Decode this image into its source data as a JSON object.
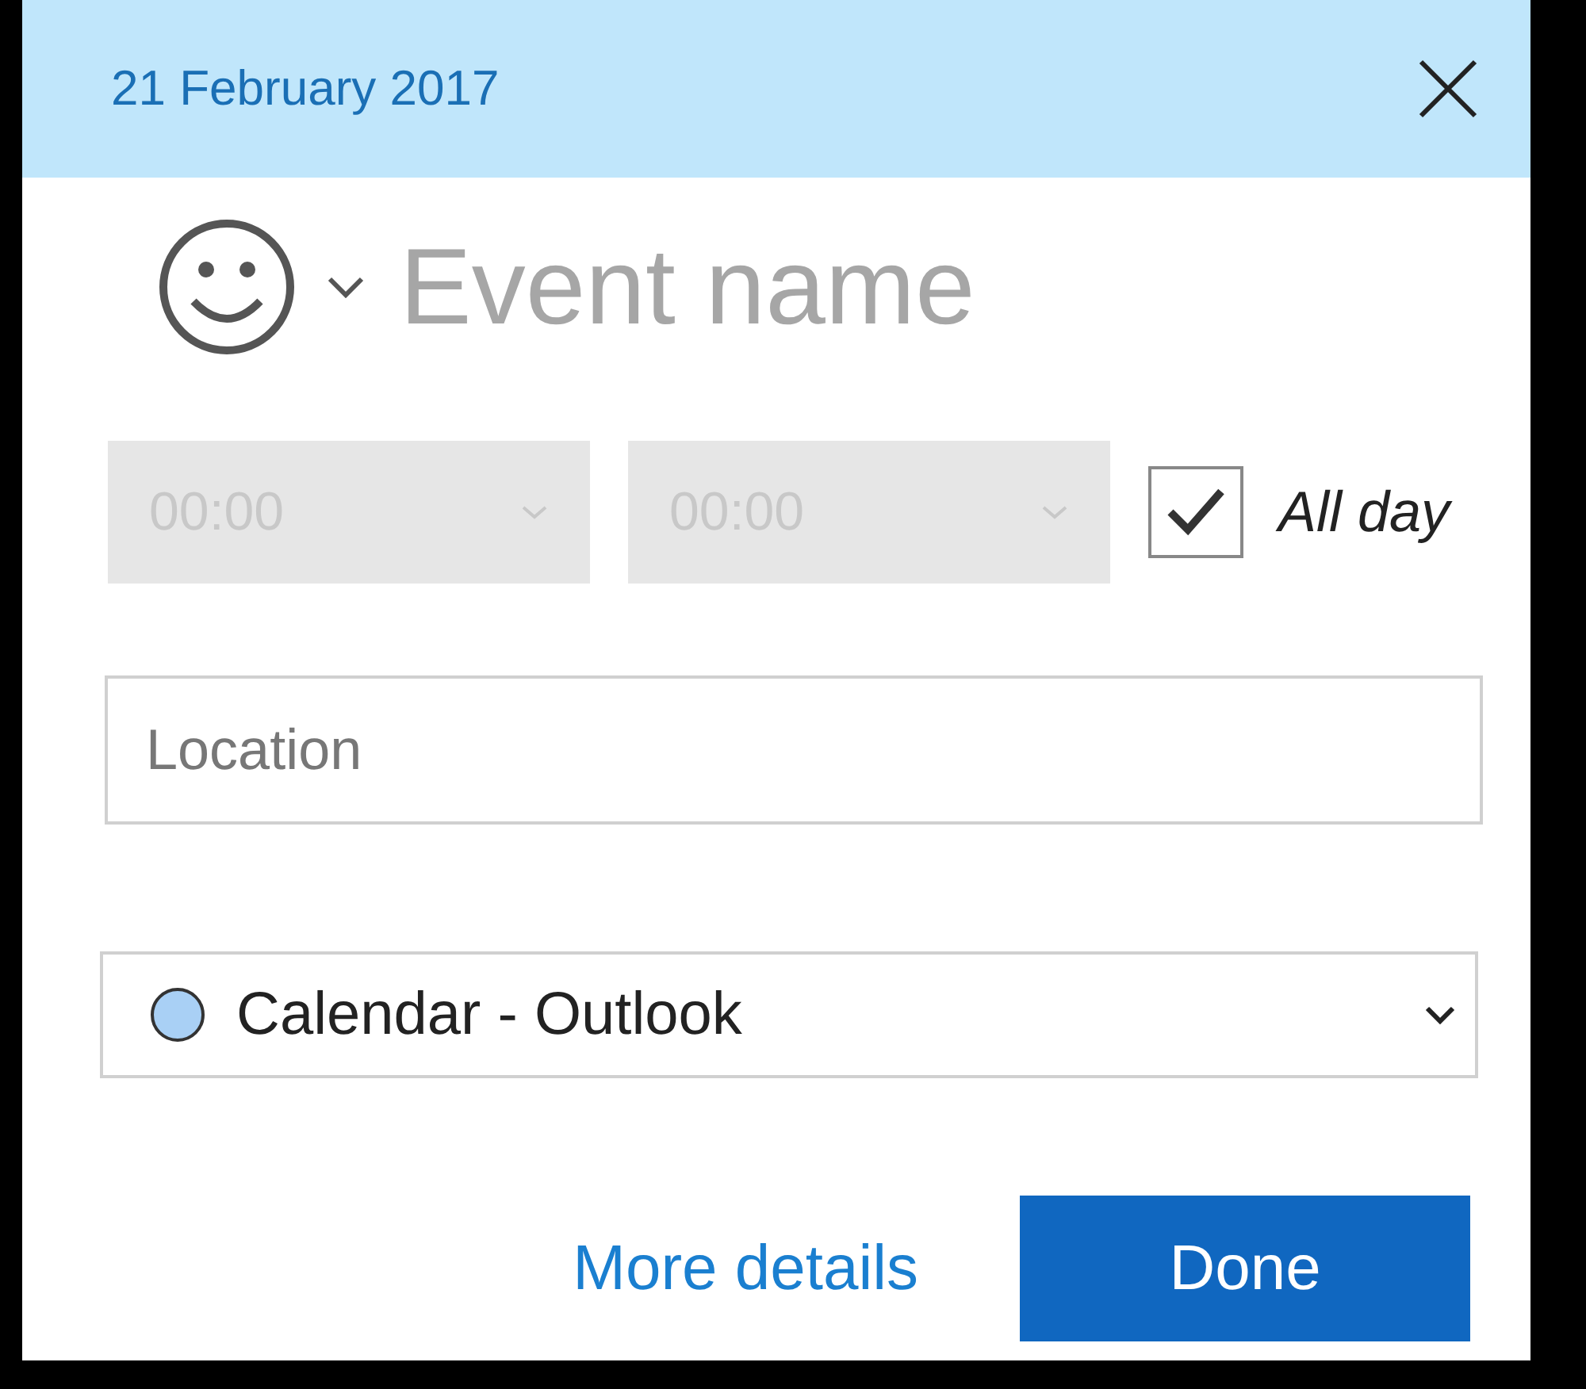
{
  "header": {
    "date": "21 February 2017"
  },
  "event": {
    "placeholder": "Event name"
  },
  "times": [
    {
      "value": "00:00",
      "disabled": true
    },
    {
      "value": "00:00",
      "disabled": true
    }
  ],
  "all_day": {
    "label": "All day",
    "checked": true
  },
  "location": {
    "placeholder": "Location"
  },
  "calendar": {
    "name": "Calendar - Outlook",
    "color": "#a9d0f5"
  },
  "actions": {
    "more_details": "More details",
    "done": "Done"
  }
}
